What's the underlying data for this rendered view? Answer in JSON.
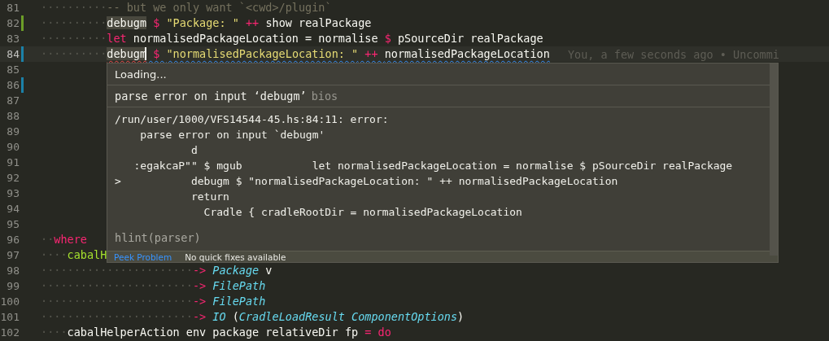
{
  "editor": {
    "lines": [
      {
        "number": "81",
        "indent": "··········",
        "tokens": [
          {
            "kind": "comment",
            "text": "-- but we only want `<cwd>/plugin`"
          }
        ]
      },
      {
        "number": "82",
        "color": "#6c9d28",
        "indent": "··········",
        "tokens": [
          {
            "kind": "plain",
            "text": "debugm",
            "highlighted": true
          },
          {
            "kind": "op",
            "text": " $ "
          },
          {
            "kind": "string",
            "text": "\"Package: \""
          },
          {
            "kind": "op",
            "text": " ++ "
          },
          {
            "kind": "plain",
            "text": "show realPackage"
          }
        ]
      },
      {
        "number": "83",
        "indent": "··········",
        "tokens": [
          {
            "kind": "keyword",
            "text": "let"
          },
          {
            "kind": "plain",
            "text": " normalisedPackageLocation = normalise "
          },
          {
            "kind": "op",
            "text": "$"
          },
          {
            "kind": "plain",
            "text": " pSourceDir realPackage"
          }
        ]
      },
      {
        "number": "84",
        "color": "#1b81a8",
        "current": true,
        "blame": "You, a few seconds ago • Uncommi",
        "indent": "··········",
        "tokens": [
          {
            "kind": "plain",
            "text": "debugm",
            "highlighted": true,
            "error_underline": true,
            "cursor_after": true
          },
          {
            "kind": "op",
            "text": " $ ",
            "info_underline": true
          },
          {
            "kind": "string",
            "text": "\"normalisedPackageLocation: \"",
            "info_underline": true
          },
          {
            "kind": "op",
            "text": " ++ ",
            "info_underline": true
          },
          {
            "kind": "plain",
            "text": "normalisedPackageLocation",
            "info_underline": true
          }
        ]
      },
      {
        "number": "85"
      },
      {
        "number": "86",
        "color": "#1b81a8"
      },
      {
        "number": "87"
      },
      {
        "number": "88"
      },
      {
        "number": "89"
      },
      {
        "number": "90"
      },
      {
        "number": "91"
      },
      {
        "number": "92"
      },
      {
        "number": "93"
      },
      {
        "number": "94"
      },
      {
        "number": "95"
      },
      {
        "number": "96",
        "indent": "··",
        "tokens": [
          {
            "kind": "keyword",
            "text": "where"
          }
        ]
      },
      {
        "number": "97",
        "indent": "····",
        "tokens": [
          {
            "kind": "fn",
            "text": "cabalH"
          }
        ]
      },
      {
        "number": "98",
        "indent": "·······················",
        "tokens": [
          {
            "kind": "op",
            "text": "-> "
          },
          {
            "kind": "type",
            "text": "Package"
          },
          {
            "kind": "plain",
            "text": " v"
          }
        ]
      },
      {
        "number": "99",
        "indent": "·······················",
        "tokens": [
          {
            "kind": "op",
            "text": "-> "
          },
          {
            "kind": "type",
            "text": "FilePath"
          }
        ]
      },
      {
        "number": "100",
        "indent": "·······················",
        "tokens": [
          {
            "kind": "op",
            "text": "-> "
          },
          {
            "kind": "type",
            "text": "FilePath"
          }
        ]
      },
      {
        "number": "101",
        "indent": "·······················",
        "tokens": [
          {
            "kind": "op",
            "text": "-> "
          },
          {
            "kind": "type",
            "text": "IO"
          },
          {
            "kind": "plain",
            "text": " ("
          },
          {
            "kind": "type",
            "text": "CradleLoadResult ComponentOptions"
          },
          {
            "kind": "plain",
            "text": ")"
          }
        ]
      },
      {
        "number": "102",
        "indent": "····",
        "tokens": [
          {
            "kind": "plain",
            "text": "cabalHelperAction env package relativeDir fp "
          },
          {
            "kind": "op",
            "text": "= do"
          }
        ]
      }
    ]
  },
  "hover": {
    "loading": "Loading...",
    "message": {
      "text": "parse error on input ‘debugm’",
      "source": "bios"
    },
    "details": [
      "/run/user/1000/VFS14544-45.hs:84:11: error:",
      "    parse error on input `debugm'",
      "            d",
      "   :egakcaP\"\" $ mgub           let normalisedPackageLocation = normalise $ pSourceDir realPackage",
      ">           debugm $ \"normalisedPackageLocation: \" ++ normalisedPackageLocation",
      "            return",
      "              Cradle { cradleRootDir = normalisedPackageLocation"
    ],
    "code": "hlint(parser)",
    "actions": {
      "link": "Peek Problem",
      "note": "No quick fixes available"
    }
  }
}
